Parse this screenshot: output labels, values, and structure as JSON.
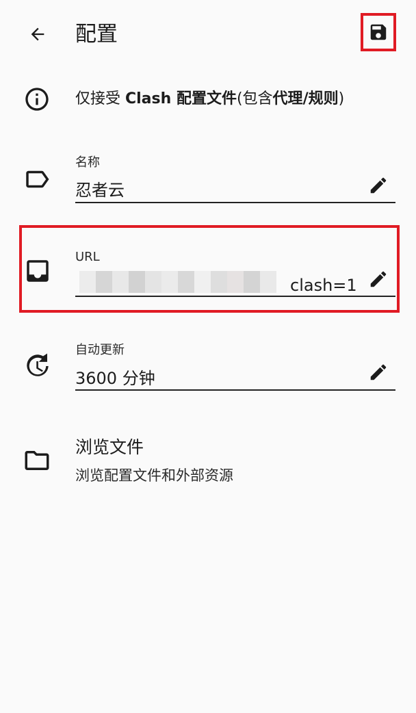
{
  "appbar": {
    "title": "配置",
    "back_icon": "arrow-left-icon",
    "save_icon": "floppy-disk-icon"
  },
  "info": {
    "icon": "info-circle-icon",
    "text_prefix": "仅接受 ",
    "text_bold1": "Clash 配置文件",
    "text_mid": "(包含",
    "text_bold2": "代理",
    "text_slash": "/",
    "text_bold3": "规则",
    "text_suffix": ")"
  },
  "fields": {
    "name": {
      "label": "名称",
      "value": "忍者云",
      "icon": "label-tag-icon"
    },
    "url": {
      "label": "URL",
      "value_visible_suffix": "clash=1",
      "icon": "inbox-tray-icon"
    },
    "update": {
      "label": "自动更新",
      "value": "3600 分钟",
      "icon": "clock-refresh-icon"
    }
  },
  "browse": {
    "title": "浏览文件",
    "subtitle": "浏览配置文件和外部资源",
    "icon": "folder-icon"
  },
  "colors": {
    "highlight": "#e01b24",
    "background": "#fafafa",
    "text": "#1c1c1c"
  }
}
